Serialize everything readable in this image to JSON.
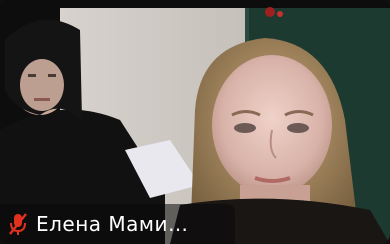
{
  "participant": {
    "name": "Елена Мами…",
    "mic_state": "muted",
    "mic_icon": "mic-off-icon",
    "mic_color": "#e0311f"
  }
}
